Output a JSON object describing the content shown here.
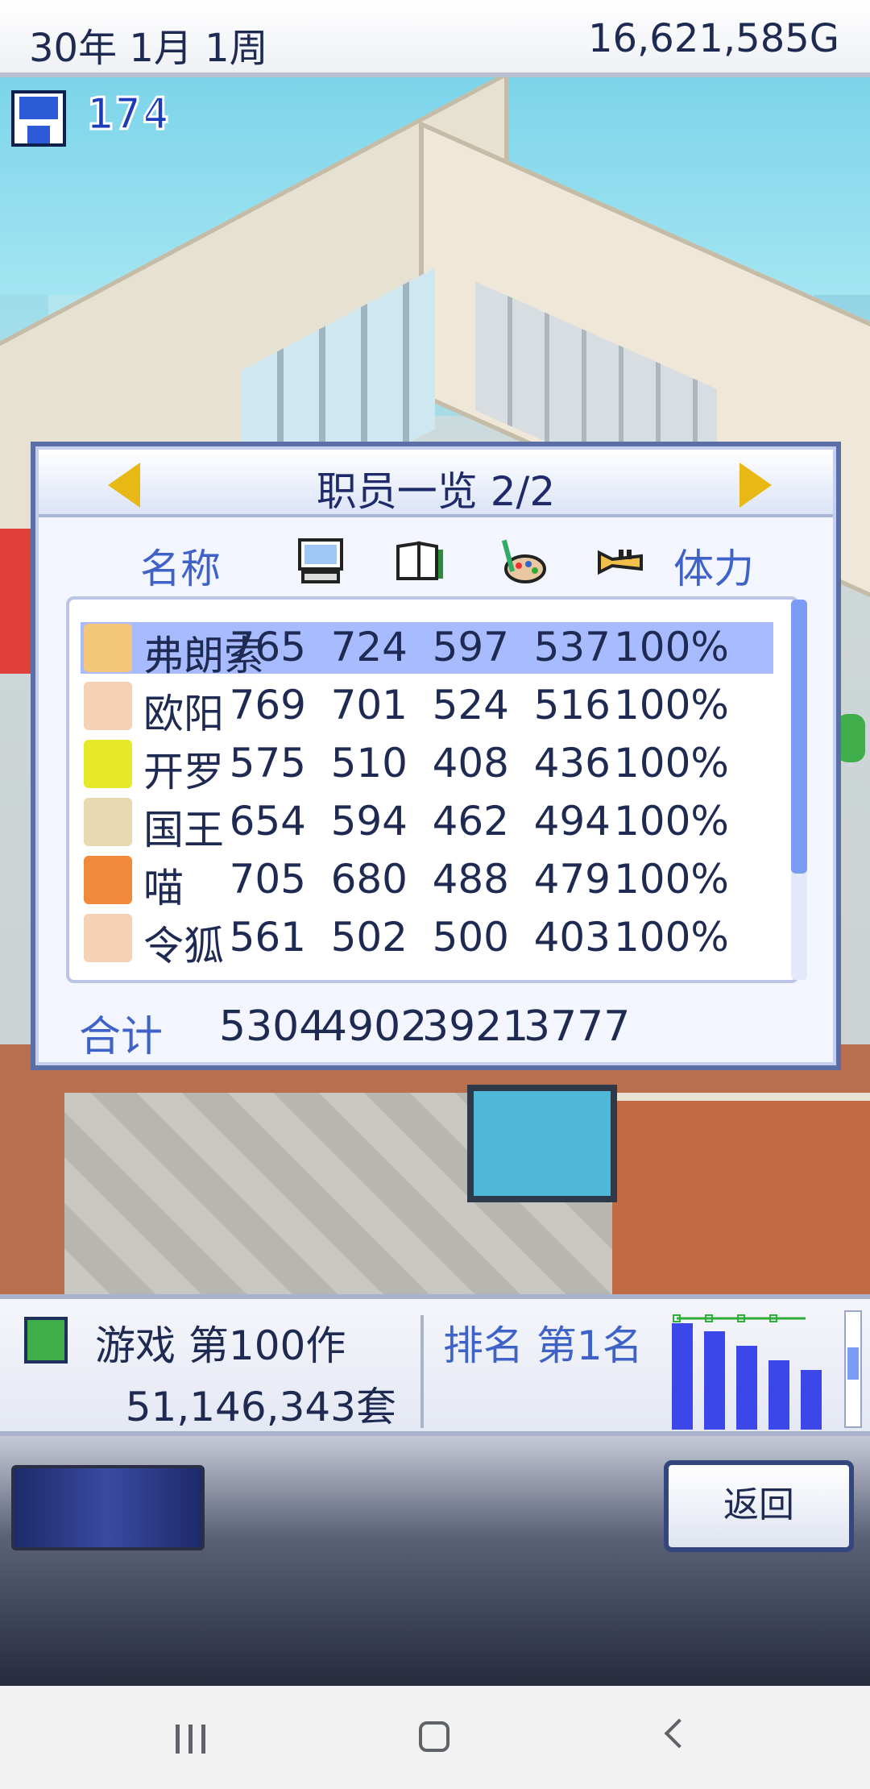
{
  "topbar": {
    "date": "30年 1月 1周",
    "money": "16,621,585G"
  },
  "save": {
    "count": "174"
  },
  "panel": {
    "title": "职员一览 2/2",
    "columns": {
      "name": "名称",
      "stamina": "体力"
    },
    "stat_icons": [
      "computer-icon",
      "book-icon",
      "paint-icon",
      "trumpet-icon"
    ],
    "rows": [
      {
        "name": "弗朗索",
        "v1": "765",
        "v2": "724",
        "v3": "597",
        "v4": "537",
        "stamina": "100%",
        "selected": true
      },
      {
        "name": "欧阳",
        "v1": "769",
        "v2": "701",
        "v3": "524",
        "v4": "516",
        "stamina": "100%"
      },
      {
        "name": "开罗",
        "v1": "575",
        "v2": "510",
        "v3": "408",
        "v4": "436",
        "stamina": "100%"
      },
      {
        "name": "国王",
        "v1": "654",
        "v2": "594",
        "v3": "462",
        "v4": "494",
        "stamina": "100%"
      },
      {
        "name": "喵",
        "v1": "705",
        "v2": "680",
        "v3": "488",
        "v4": "479",
        "stamina": "100%"
      },
      {
        "name": "令狐",
        "v1": "561",
        "v2": "502",
        "v3": "500",
        "v4": "403",
        "stamina": "100%"
      }
    ],
    "total": {
      "label": "合计",
      "values": [
        "5304",
        "4902",
        "3921",
        "3777"
      ]
    }
  },
  "infobar": {
    "game_label": "游戏 第100作",
    "sales": "51,146,343套",
    "rank": "排名 第1名"
  },
  "controls": {
    "back_label": "返回"
  },
  "colors": {
    "accent": "#3e62c8",
    "selected_row": "#a8bbff",
    "panel_border": "#5b6ea5"
  }
}
